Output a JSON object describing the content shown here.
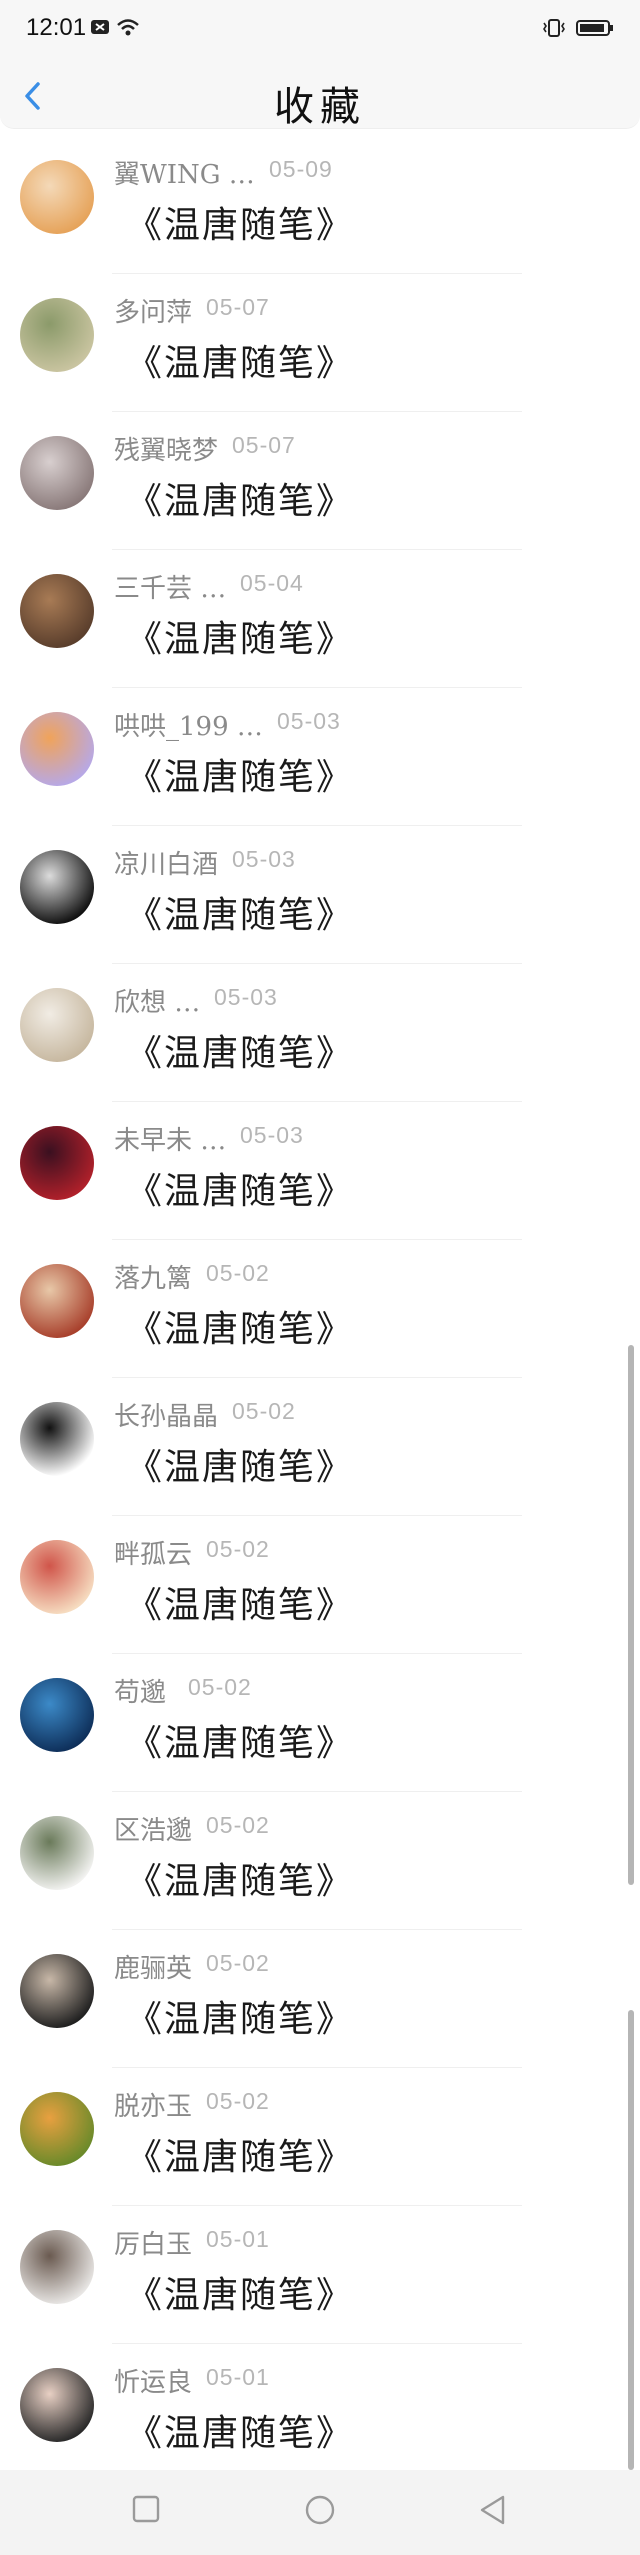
{
  "status_bar": {
    "time": "12:01",
    "icons": [
      "sim-card-icon",
      "wifi-icon",
      "vibrate-icon",
      "battery-icon"
    ]
  },
  "header": {
    "title": "收藏",
    "back_icon": "chevron-left-icon",
    "accent_color": "#3a8ee6"
  },
  "favorites": [
    {
      "user": "翼WING …",
      "date": "05-09",
      "book": "《温唐随笔》",
      "avatar_colors": [
        "#e6a35a",
        "#f4d9b8"
      ]
    },
    {
      "user": "多问萍",
      "date": "05-07",
      "book": "《温唐随笔》",
      "avatar_colors": [
        "#c9c4a0",
        "#8b9a6a"
      ]
    },
    {
      "user": "残翼晓梦",
      "date": "05-07",
      "book": "《温唐随笔》",
      "avatar_colors": [
        "#8a7a7a",
        "#d8cfcf"
      ]
    },
    {
      "user": "三千芸 …",
      "date": "05-04",
      "book": "《温唐随笔》",
      "avatar_colors": [
        "#5a3e2c",
        "#a87b55"
      ]
    },
    {
      "user": "哄哄_199 …",
      "date": "05-03",
      "book": "《温唐随笔》",
      "avatar_colors": [
        "#b7a8e6",
        "#f0a35a"
      ]
    },
    {
      "user": "凉川白酒",
      "date": "05-03",
      "book": "《温唐随笔》",
      "avatar_colors": [
        "#111111",
        "#dcdcdc"
      ]
    },
    {
      "user": "欣想 …",
      "date": "05-03",
      "book": "《温唐随笔》",
      "avatar_colors": [
        "#c7b8a0",
        "#f1ece4"
      ]
    },
    {
      "user": "未早未 …",
      "date": "05-03",
      "book": "《温唐随笔》",
      "avatar_colors": [
        "#b0202a",
        "#3a1020"
      ]
    },
    {
      "user": "落九篱",
      "date": "05-02",
      "book": "《温唐随笔》",
      "avatar_colors": [
        "#a8402c",
        "#e8c8a8"
      ]
    },
    {
      "user": "长孙晶晶",
      "date": "05-02",
      "book": "《温唐随笔》",
      "avatar_colors": [
        "#ffffff",
        "#111111"
      ]
    },
    {
      "user": "畔孤云",
      "date": "05-02",
      "book": "《温唐随笔》",
      "avatar_colors": [
        "#f6dcc0",
        "#d0554a"
      ]
    },
    {
      "user": "苟邈",
      "date": "05-02",
      "book": "《温唐随笔》",
      "avatar_colors": [
        "#0e2f5a",
        "#3c8ac8"
      ]
    },
    {
      "user": "区浩邈",
      "date": "05-02",
      "book": "《温唐随笔》",
      "avatar_colors": [
        "#f2f2f0",
        "#6a7a5a"
      ]
    },
    {
      "user": "鹿骊英",
      "date": "05-02",
      "book": "《温唐随笔》",
      "avatar_colors": [
        "#202020",
        "#c8b8a8"
      ]
    },
    {
      "user": "脱亦玉",
      "date": "05-02",
      "book": "《温唐随笔》",
      "avatar_colors": [
        "#6a8a2a",
        "#e8a040"
      ]
    },
    {
      "user": "厉白玉",
      "date": "05-01",
      "book": "《温唐随笔》",
      "avatar_colors": [
        "#e8e6e4",
        "#6a5a50"
      ]
    },
    {
      "user": "忻运良",
      "date": "05-01",
      "book": "《温唐随笔》",
      "avatar_colors": [
        "#2a2a2a",
        "#e8d0c4"
      ]
    }
  ],
  "nav_bar": {
    "icons": [
      "recent-apps-icon",
      "home-icon",
      "back-triangle-icon"
    ]
  }
}
